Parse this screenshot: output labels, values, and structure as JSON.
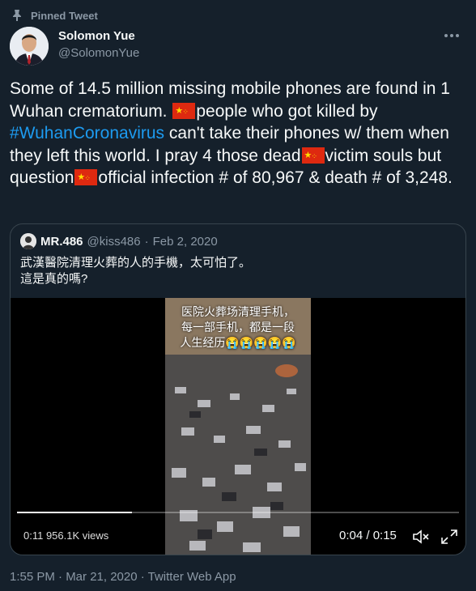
{
  "pinned": {
    "label": "Pinned Tweet"
  },
  "author": {
    "name": "Solomon Yue",
    "handle": "@SolomonYue"
  },
  "tweet": {
    "part1": "Some of 14.5 million missing mobile phones are found in 1 Wuhan crematorium. ",
    "part2": "people who got killed by ",
    "hashtag": "#WuhanCoronavirus",
    "part3": " can't take their phones w/ them when they left this world. I pray 4 those dead",
    "part4": "victim souls but question",
    "part5": "official infection # of 80,967 & death # of 3,248."
  },
  "quote": {
    "name": "MR.486",
    "handle": "@kiss486",
    "separator": "·",
    "date": "Feb 2, 2020",
    "line1": "武漢醫院清理火葬的人的手機，太可怕了。",
    "line2": "這是真的嗎?",
    "video": {
      "overlay_line1": "医院火葬场清理手机，",
      "overlay_line2": "每一部手机，都是一段",
      "overlay_line3": "人生经历😭😭😭😭😭",
      "views": "0:11 956.1K views",
      "time": "0:04 / 0:15",
      "progress": 0.26
    }
  },
  "footer": {
    "timestamp": "1:55 PM · Mar 21, 2020 · Twitter Web App"
  },
  "colors": {
    "background": "#15202b",
    "link": "#1d9bf0",
    "muted": "#8b98a5"
  }
}
